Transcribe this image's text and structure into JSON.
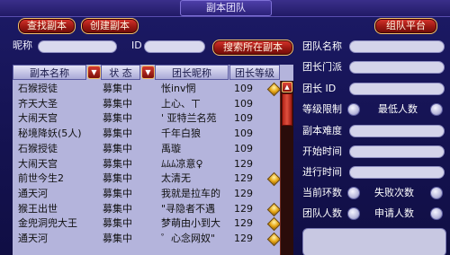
{
  "window": {
    "title": "副本团队"
  },
  "toolbar": {
    "search_dungeon": "查找副本",
    "create_dungeon": "创建副本",
    "team_platform": "组队平台",
    "search_location": "搜索所在副本"
  },
  "search": {
    "nickname_label": "昵称",
    "id_label": "ID",
    "nickname_value": "",
    "id_value": ""
  },
  "table": {
    "headers": [
      "副本名称",
      "状 态",
      "团长昵称",
      "团长等级"
    ],
    "rows": [
      {
        "dungeon": "石猴授徒",
        "status": "募集中",
        "leader": "怅inv惘",
        "level": "109",
        "gold": true
      },
      {
        "dungeon": "齐天大圣",
        "status": "募集中",
        "leader": "上心、ㄒ",
        "level": "109",
        "gold": false
      },
      {
        "dungeon": "大闹天宫",
        "status": "募集中",
        "leader": "' 亚特兰名苑",
        "level": "109",
        "gold": false
      },
      {
        "dungeon": "秘境降妖(5人)",
        "status": "募集中",
        "leader": "千年白狼",
        "level": "109",
        "gold": false
      },
      {
        "dungeon": "石猴授徒",
        "status": "募集中",
        "leader": "禹璇",
        "level": "109",
        "gold": false
      },
      {
        "dungeon": "大闹天宫",
        "status": "募集中",
        "leader": "ﾑﾑﾑ凉意♀",
        "level": "129",
        "gold": false
      },
      {
        "dungeon": "前世今生2",
        "status": "募集中",
        "leader": "太清无",
        "level": "129",
        "gold": true
      },
      {
        "dungeon": "通天河",
        "status": "募集中",
        "leader": "我就是拉车的",
        "level": "129",
        "gold": false
      },
      {
        "dungeon": "猴王出世",
        "status": "募集中",
        "leader": "\"寻隐者不遇",
        "level": "129",
        "gold": true
      },
      {
        "dungeon": "金兜洞兜大王",
        "status": "募集中",
        "leader": "梦萌由小到大",
        "level": "129",
        "gold": true
      },
      {
        "dungeon": "通天河",
        "status": "募集中",
        "leader": "゜心念网奴\"",
        "level": "129",
        "gold": true
      }
    ]
  },
  "details": {
    "team_name": "团队名称",
    "leader_sect": "团长门派",
    "leader_id": "团长 ID",
    "level_limit": "等级限制",
    "min_members": "最低人数",
    "difficulty": "副本难度",
    "start_time": "开始时间",
    "elapsed_time": "进行时间",
    "current_rounds": "当前环数",
    "fail_count": "失败次数",
    "team_size": "团队人数",
    "applicants": "申请人数"
  }
}
